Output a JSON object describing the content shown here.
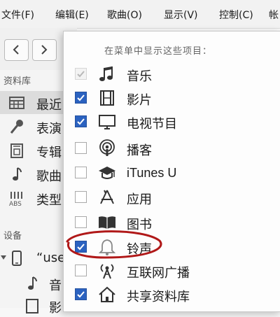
{
  "menubar": {
    "items": [
      "文件(F)",
      "编辑(E)",
      "歌曲(O)",
      "显示(V)",
      "控制(C)",
      "帐"
    ]
  },
  "sidebar": {
    "library_title": "资料库",
    "items": [
      {
        "label": "最近",
        "icon": "calendar-grid-icon",
        "selected": true
      },
      {
        "label": "表演",
        "icon": "microphone-icon"
      },
      {
        "label": "专辑",
        "icon": "album-icon"
      },
      {
        "label": "歌曲",
        "icon": "music-note-icon"
      },
      {
        "label": "类型",
        "icon": "genre-icon"
      }
    ],
    "devices_title": "设备",
    "device": {
      "label": "“use",
      "icon": "phone-icon"
    },
    "device_children": [
      {
        "label": "音",
        "icon": "music-note-icon"
      },
      {
        "label": "影",
        "icon": "film-icon"
      }
    ]
  },
  "popup": {
    "title": "在菜单中显示这些项目：",
    "items": [
      {
        "label": "音乐",
        "icon": "music-note-icon",
        "checked": true,
        "disabled": true
      },
      {
        "label": "影片",
        "icon": "film-icon",
        "checked": true
      },
      {
        "label": "电视节目",
        "icon": "tv-icon",
        "checked": true
      },
      {
        "label": "播客",
        "icon": "podcast-icon",
        "checked": false
      },
      {
        "label": "iTunes U",
        "icon": "graduation-cap-icon",
        "checked": false
      },
      {
        "label": "应用",
        "icon": "app-store-icon",
        "checked": false
      },
      {
        "label": "图书",
        "icon": "book-icon",
        "checked": false
      },
      {
        "label": "铃声",
        "icon": "bell-icon",
        "checked": true
      },
      {
        "label": "互联网广播",
        "icon": "radio-antenna-icon",
        "checked": false
      },
      {
        "label": "共享资料库",
        "icon": "home-icon",
        "checked": true
      }
    ]
  },
  "colors": {
    "checkbox_checked": "#2b62c0",
    "annotation_circle": "#b01818"
  }
}
